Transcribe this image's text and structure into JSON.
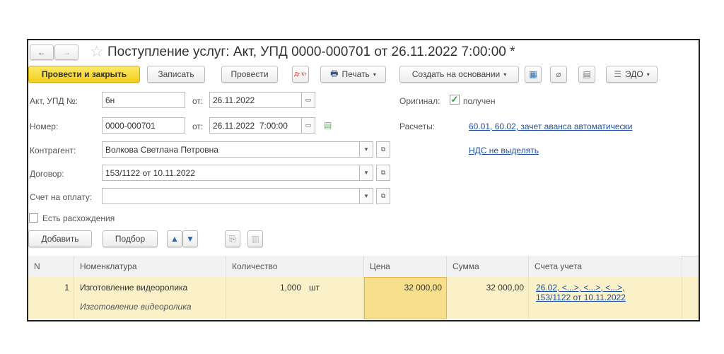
{
  "title": "Поступление услуг: Акт, УПД 0000-000701 от 26.11.2022 7:00:00 *",
  "toolbar": {
    "post_close": "Провести и закрыть",
    "save": "Записать",
    "post": "Провести",
    "dtkt": "Дт Кт",
    "print": "Печать",
    "create_based": "Создать на основании",
    "edo": "ЭДО"
  },
  "form": {
    "act_label": "Акт, УПД №:",
    "act_value": "6н",
    "from_label": "от:",
    "act_date": "26.11.2022",
    "number_label": "Номер:",
    "number_value": "0000-000701",
    "number_date": "26.11.2022  7:00:00",
    "contractor_label": "Контрагент:",
    "contractor_value": "Волкова Светлана Петровна",
    "contract_label": "Договор:",
    "contract_value": "153/1122 от 10.11.2022",
    "invoice_label": "Счет на оплату:",
    "invoice_value": "",
    "original_label": "Оригинал:",
    "original_value": "получен",
    "original_checked": true,
    "settlements_label": "Расчеты:",
    "settlements_link": "60.01, 60.02, зачет аванса автоматически",
    "vat_link": "НДС не выделять",
    "discrepancy_label": "Есть расхождения",
    "discrepancy_checked": false
  },
  "table_toolbar": {
    "add": "Добавить",
    "pick": "Подбор"
  },
  "table": {
    "headers": [
      "N",
      "Номенклатура",
      "Количество",
      "Цена",
      "Сумма",
      "Счета учета"
    ],
    "rows": [
      {
        "n": "1",
        "item": "Изготовление видеоролика",
        "item_desc": "Изготовление видеоролика",
        "qty": "1,000",
        "unit": "шт",
        "price": "32 000,00",
        "sum": "32 000,00",
        "accounts_line1": "26.02, <...>, <...>, <...>,",
        "accounts_line2": "153/1122 от 10.11.2022"
      }
    ]
  }
}
